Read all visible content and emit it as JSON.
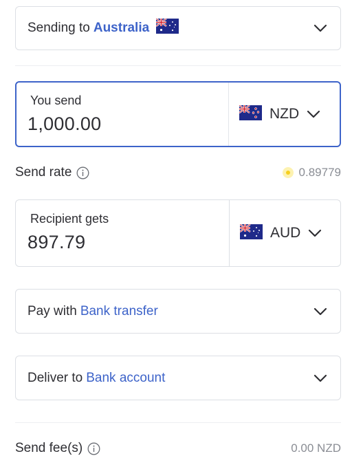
{
  "destination": {
    "prefix": "Sending to",
    "country": "Australia",
    "flag_icon": "australia-flag-icon"
  },
  "you_send": {
    "label": "You send",
    "amount": "1,000.00",
    "currency": "NZD",
    "flag_icon": "new-zealand-flag-icon"
  },
  "send_rate": {
    "label": "Send rate",
    "value": "0.89779"
  },
  "recipient_gets": {
    "label": "Recipient gets",
    "amount": "897.79",
    "currency": "AUD",
    "flag_icon": "australia-flag-icon"
  },
  "pay_with": {
    "prefix": "Pay with",
    "method": "Bank transfer"
  },
  "deliver_to": {
    "prefix": "Deliver to",
    "method": "Bank account"
  },
  "send_fees": {
    "label": "Send fee(s)",
    "value": "0.00 NZD"
  },
  "colors": {
    "accent": "#3d63c9",
    "border": "#dcdfe4",
    "text": "#2e2e33",
    "muted": "#8a8d94",
    "rate_indicator": "#f6cf1e"
  }
}
